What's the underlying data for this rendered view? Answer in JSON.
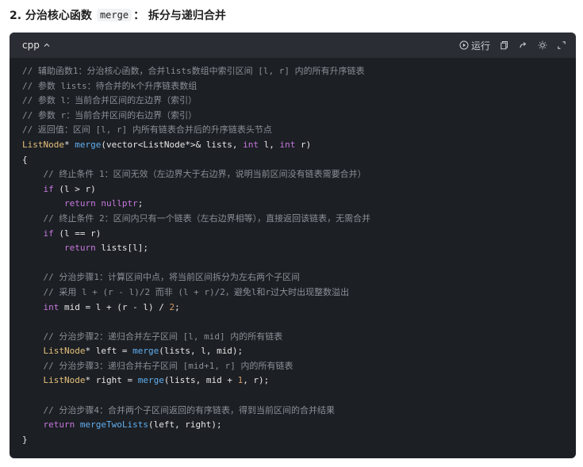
{
  "heading": {
    "prefix": "2. 分治核心函数 ",
    "code": "merge",
    "suffix": "： 拆分与递归合并"
  },
  "toolbar": {
    "language": "cpp",
    "run_label": "运行"
  },
  "code_lines": [
    [
      {
        "c": "c",
        "t": "// 辅助函数1：分治核心函数，合并lists数组中索引区间 [l, r] 内的所有升序链表"
      }
    ],
    [
      {
        "c": "c",
        "t": "// 参数 lists：待合并的k个升序链表数组"
      }
    ],
    [
      {
        "c": "c",
        "t": "// 参数 l：当前合并区间的左边界（索引）"
      }
    ],
    [
      {
        "c": "c",
        "t": "// 参数 r：当前合并区间的右边界（索引）"
      }
    ],
    [
      {
        "c": "c",
        "t": "// 返回值：区间 [l, r] 内所有链表合并后的升序链表头节点"
      }
    ],
    [
      {
        "c": "t",
        "t": "ListNode"
      },
      {
        "c": "p",
        "t": "* "
      },
      {
        "c": "f",
        "t": "merge"
      },
      {
        "c": "p",
        "t": "(vector<ListNode*>& lists, "
      },
      {
        "c": "k",
        "t": "int"
      },
      {
        "c": "p",
        "t": " l, "
      },
      {
        "c": "k",
        "t": "int"
      },
      {
        "c": "p",
        "t": " r)"
      }
    ],
    [
      {
        "c": "p",
        "t": "{"
      }
    ],
    [
      {
        "c": "c",
        "t": "    // 终止条件 1：区间无效（左边界大于右边界，说明当前区间没有链表需要合并）"
      }
    ],
    [
      {
        "c": "k",
        "t": "    if"
      },
      {
        "c": "p",
        "t": " (l > r)"
      }
    ],
    [
      {
        "c": "k",
        "t": "        return"
      },
      {
        "c": "p",
        "t": " "
      },
      {
        "c": "k",
        "t": "nullptr"
      },
      {
        "c": "p",
        "t": ";"
      }
    ],
    [
      {
        "c": "c",
        "t": "    // 终止条件 2：区间内只有一个链表（左右边界相等），直接返回该链表，无需合并"
      }
    ],
    [
      {
        "c": "k",
        "t": "    if"
      },
      {
        "c": "p",
        "t": " (l == r)"
      }
    ],
    [
      {
        "c": "k",
        "t": "        return"
      },
      {
        "c": "p",
        "t": " lists[l];"
      }
    ],
    [
      {
        "c": "p",
        "t": " "
      }
    ],
    [
      {
        "c": "c",
        "t": "    // 分治步骤1：计算区间中点，将当前区间拆分为左右两个子区间"
      }
    ],
    [
      {
        "c": "c",
        "t": "    // 采用 l + (r - l)/2 而非 (l + r)/2，避免l和r过大时出现整数溢出"
      }
    ],
    [
      {
        "c": "k",
        "t": "    int"
      },
      {
        "c": "p",
        "t": " mid = l + (r - l) / "
      },
      {
        "c": "n",
        "t": "2"
      },
      {
        "c": "p",
        "t": ";"
      }
    ],
    [
      {
        "c": "p",
        "t": " "
      }
    ],
    [
      {
        "c": "c",
        "t": "    // 分治步骤2：递归合并左子区间 [l, mid] 内的所有链表"
      }
    ],
    [
      {
        "c": "t",
        "t": "    ListNode"
      },
      {
        "c": "p",
        "t": "* left = "
      },
      {
        "c": "f",
        "t": "merge"
      },
      {
        "c": "p",
        "t": "(lists, l, mid);"
      }
    ],
    [
      {
        "c": "c",
        "t": "    // 分治步骤3：递归合并右子区间 [mid+1, r] 内的所有链表"
      }
    ],
    [
      {
        "c": "t",
        "t": "    ListNode"
      },
      {
        "c": "p",
        "t": "* right = "
      },
      {
        "c": "f",
        "t": "merge"
      },
      {
        "c": "p",
        "t": "(lists, mid + "
      },
      {
        "c": "n",
        "t": "1"
      },
      {
        "c": "p",
        "t": ", r);"
      }
    ],
    [
      {
        "c": "p",
        "t": " "
      }
    ],
    [
      {
        "c": "c",
        "t": "    // 分治步骤4：合并两个子区间返回的有序链表，得到当前区间的合并结果"
      }
    ],
    [
      {
        "c": "k",
        "t": "    return"
      },
      {
        "c": "p",
        "t": " "
      },
      {
        "c": "f",
        "t": "mergeTwoLists"
      },
      {
        "c": "p",
        "t": "(left, right);"
      }
    ],
    [
      {
        "c": "p",
        "t": "}"
      }
    ]
  ]
}
